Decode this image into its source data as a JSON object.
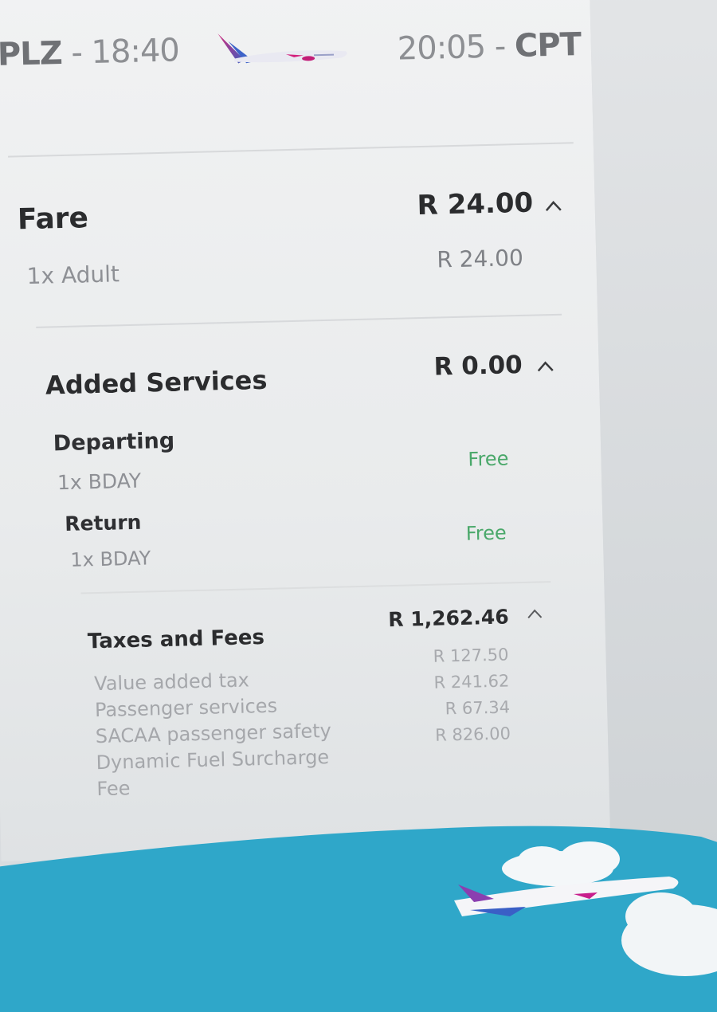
{
  "flight": {
    "origin_code": "PLZ",
    "departure_time": "18:40",
    "arrival_time": "20:05",
    "destination_code": "CPT"
  },
  "fare": {
    "title": "Fare",
    "total": "R 24.00",
    "items": [
      {
        "label": "1x Adult",
        "value": "R 24.00"
      }
    ]
  },
  "added_services": {
    "title": "Added Services",
    "total": "R 0.00",
    "groups": [
      {
        "heading": "Departing",
        "item": "1x BDAY",
        "value": "Free"
      },
      {
        "heading": "Return",
        "item": "1x BDAY",
        "value": "Free"
      }
    ]
  },
  "taxes": {
    "title": "Taxes and Fees",
    "total": "R 1,262.46",
    "items": [
      {
        "label": "Value added tax",
        "value": "R 127.50"
      },
      {
        "label": "Passenger services",
        "value": "R 241.62"
      },
      {
        "label": "SACAA passenger safety",
        "value": "R 67.34"
      },
      {
        "label": "Dynamic Fuel Surcharge",
        "value": "R 826.00"
      },
      {
        "label": "Fee",
        "value": ""
      }
    ]
  },
  "colors": {
    "accent_free": "#4aa86a",
    "banner_blue": "#2fa7c9",
    "brand_magenta": "#c81e8c"
  }
}
